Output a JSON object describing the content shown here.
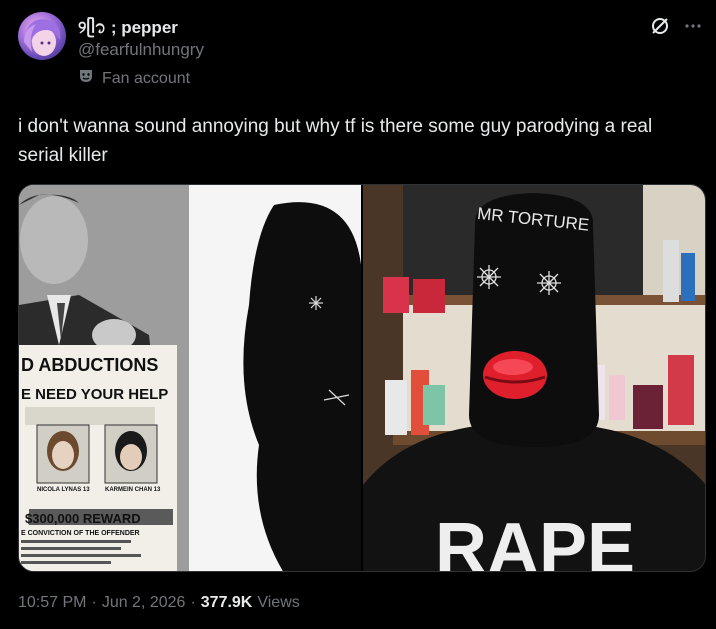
{
  "author": {
    "display_name": "୨ᥫ᭡ ; pepper",
    "handle": "@fearfulnhungry",
    "label_icon": "theater-mask-icon",
    "label": "Fan account"
  },
  "header_actions": {
    "grok_icon": "grok-icon",
    "more_icon": "more-icon"
  },
  "tweet": {
    "text": "i don't wanna sound annoying but why tf is there some guy parodying a real serial killer"
  },
  "media": {
    "left_image": {
      "headline": "D ABDUCTIONS",
      "subhead": "E NEED YOUR HELP",
      "victim_1": "NICOLA LYNAS 13",
      "victim_2": "KARMEIN CHAN 13",
      "reward": "$300,000 REWARD",
      "conviction": "E CONVICTION OF THE OFFENDER"
    },
    "right_image": {
      "mask_text": "MR TORTURE",
      "shirt_text": "RAPE"
    }
  },
  "meta": {
    "time": "10:57 PM",
    "sep1": "·",
    "date": "Jun 2, 2026",
    "sep2": "·",
    "views_count": "377.9K",
    "views_label": "Views"
  }
}
